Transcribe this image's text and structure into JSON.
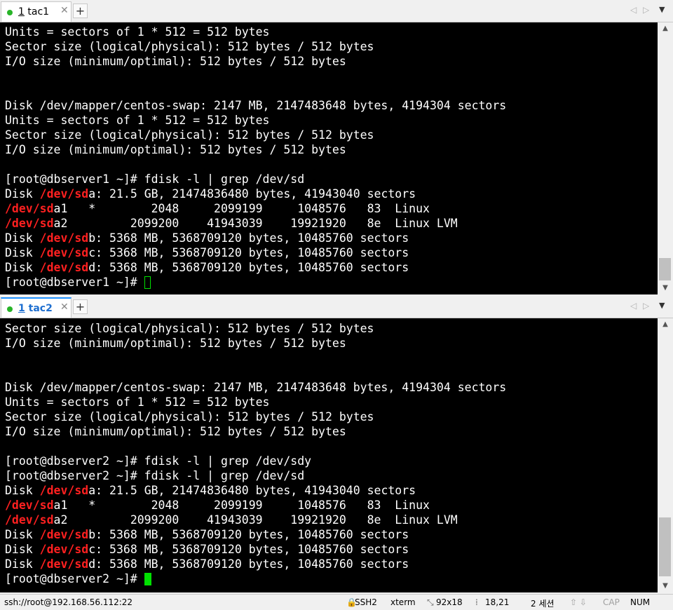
{
  "tab1": {
    "number": "1",
    "name": "tac1",
    "close": "✕",
    "add": "+"
  },
  "tab2": {
    "number": "1",
    "name": "tac2",
    "close": "✕",
    "add": "+"
  },
  "tab_nav": {
    "prev": "◁",
    "next": "▷",
    "menu": "▼"
  },
  "term1": {
    "lines": [
      "Units = sectors of 1 * 512 = 512 bytes",
      "Sector size (logical/physical): 512 bytes / 512 bytes",
      "I/O size (minimum/optimal): 512 bytes / 512 bytes",
      "",
      "",
      "Disk /dev/mapper/centos-swap: 2147 MB, 2147483648 bytes, 4194304 sectors",
      "Units = sectors of 1 * 512 = 512 bytes",
      "Sector size (logical/physical): 512 bytes / 512 bytes",
      "I/O size (minimum/optimal): 512 bytes / 512 bytes",
      "",
      "[root@dbserver1 ~]# fdisk -l | grep /dev/sd"
    ],
    "grep_lines": [
      {
        "pre": "Disk ",
        "hl": "/dev/sd",
        "post": "a: 21.5 GB, 21474836480 bytes, 41943040 sectors"
      },
      {
        "pre": "",
        "hl": "/dev/sd",
        "post": "a1   *        2048     2099199     1048576   83  Linux"
      },
      {
        "pre": "",
        "hl": "/dev/sd",
        "post": "a2         2099200    41943039    19921920   8e  Linux LVM"
      },
      {
        "pre": "Disk ",
        "hl": "/dev/sd",
        "post": "b: 5368 MB, 5368709120 bytes, 10485760 sectors"
      },
      {
        "pre": "Disk ",
        "hl": "/dev/sd",
        "post": "c: 5368 MB, 5368709120 bytes, 10485760 sectors"
      },
      {
        "pre": "Disk ",
        "hl": "/dev/sd",
        "post": "d: 5368 MB, 5368709120 bytes, 10485760 sectors"
      }
    ],
    "prompt": "[root@dbserver1 ~]# "
  },
  "term2": {
    "lines": [
      "Sector size (logical/physical): 512 bytes / 512 bytes",
      "I/O size (minimum/optimal): 512 bytes / 512 bytes",
      "",
      "",
      "Disk /dev/mapper/centos-swap: 2147 MB, 2147483648 bytes, 4194304 sectors",
      "Units = sectors of 1 * 512 = 512 bytes",
      "Sector size (logical/physical): 512 bytes / 512 bytes",
      "I/O size (minimum/optimal): 512 bytes / 512 bytes",
      "",
      "[root@dbserver2 ~]# fdisk -l | grep /dev/sdy",
      "[root@dbserver2 ~]# fdisk -l | grep /dev/sd"
    ],
    "grep_lines": [
      {
        "pre": "Disk ",
        "hl": "/dev/sd",
        "post": "a: 21.5 GB, 21474836480 bytes, 41943040 sectors"
      },
      {
        "pre": "",
        "hl": "/dev/sd",
        "post": "a1   *        2048     2099199     1048576   83  Linux"
      },
      {
        "pre": "",
        "hl": "/dev/sd",
        "post": "a2         2099200    41943039    19921920   8e  Linux LVM"
      },
      {
        "pre": "Disk ",
        "hl": "/dev/sd",
        "post": "b: 5368 MB, 5368709120 bytes, 10485760 sectors"
      },
      {
        "pre": "Disk ",
        "hl": "/dev/sd",
        "post": "c: 5368 MB, 5368709120 bytes, 10485760 sectors"
      },
      {
        "pre": "Disk ",
        "hl": "/dev/sd",
        "post": "d: 5368 MB, 5368709120 bytes, 10485760 sectors"
      }
    ],
    "prompt": "[root@dbserver2 ~]# "
  },
  "scroll": {
    "up": "▲",
    "down": "▼"
  },
  "status": {
    "connection": "ssh://root@192.168.56.112:22",
    "protocol": "SSH2",
    "term_type": "xterm",
    "size": "92x18",
    "cursor_pos": "18,21",
    "sessions": "2 세션",
    "arrows": "⇧ ⇩",
    "cap": "CAP",
    "num": "NUM"
  },
  "colors": {
    "accent": "#1e90ff",
    "tab_dot": "#28b428",
    "highlight": "#ff2020",
    "cursor": "#00e000"
  }
}
